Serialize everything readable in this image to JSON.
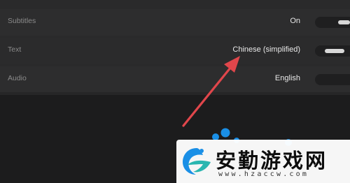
{
  "settings": {
    "rows": [
      {
        "label": "Subtitles",
        "value": "On"
      },
      {
        "label": "Text",
        "value": "Chinese (simplified)"
      },
      {
        "label": "Audio",
        "value": "English"
      }
    ]
  },
  "watermark": {
    "title": "安勤游戏网",
    "url": "www.hzaccw.com"
  },
  "colors": {
    "background": "#1c1c1d",
    "panel": "#2a2a2b",
    "arrow": "#e0464b",
    "logo_blue": "#1a8fe6",
    "logo_teal": "#29b6b0"
  },
  "icons": {
    "annotation": "red-arrow-icon",
    "logo": "site-logo-icon"
  }
}
